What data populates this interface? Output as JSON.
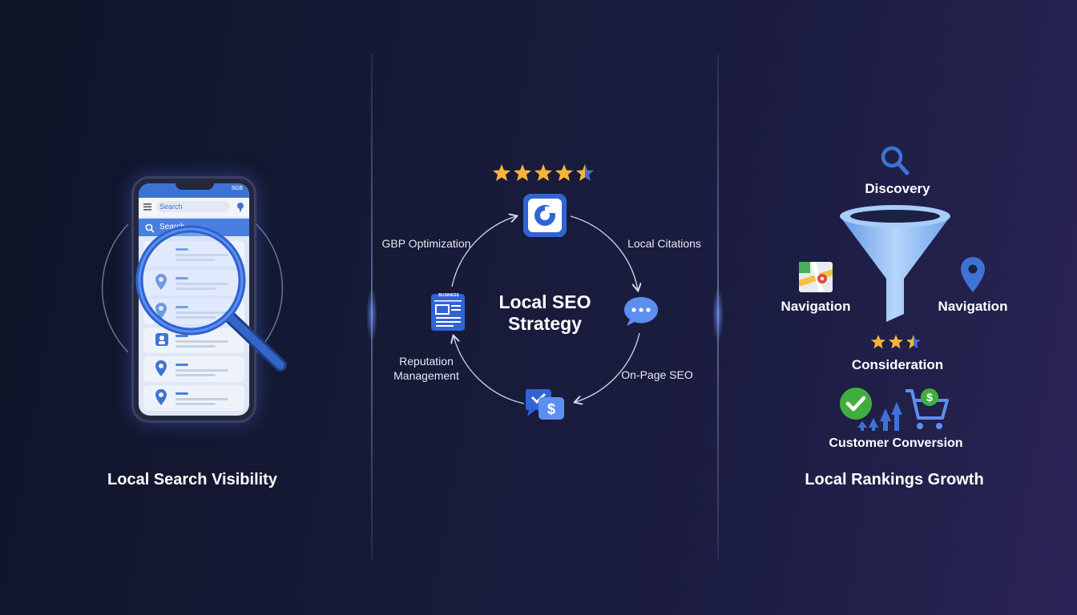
{
  "panels": {
    "left_title": "Local Search Visibility",
    "middle_title": "Local SEO\nStrategy",
    "right_title": "Local Rankings Growth"
  },
  "phone": {
    "status": "5GB",
    "search_pill": "Search",
    "search_bar": "Search"
  },
  "cycle": {
    "gbp": "GBP Optimization",
    "citations": "Local Citations",
    "onpage": "On-Page SEO",
    "reputation_line1": "Reputation",
    "reputation_line2": "Management",
    "doc_header": "BUSINESS"
  },
  "funnel": {
    "discovery": "Discovery",
    "nav_left": "Navigation",
    "nav_right": "Navigation",
    "consideration": "Consideration",
    "conversion": "Customer Conversion",
    "dollar_sign": "$"
  },
  "ratings": {
    "top_stars": 4.5,
    "consideration_stars": 2.5
  },
  "colors": {
    "star": "#f5b53a",
    "accent_blue": "#3e73d6",
    "check_green": "#3fae3f",
    "funnel_blue": "#8fbcf2"
  }
}
